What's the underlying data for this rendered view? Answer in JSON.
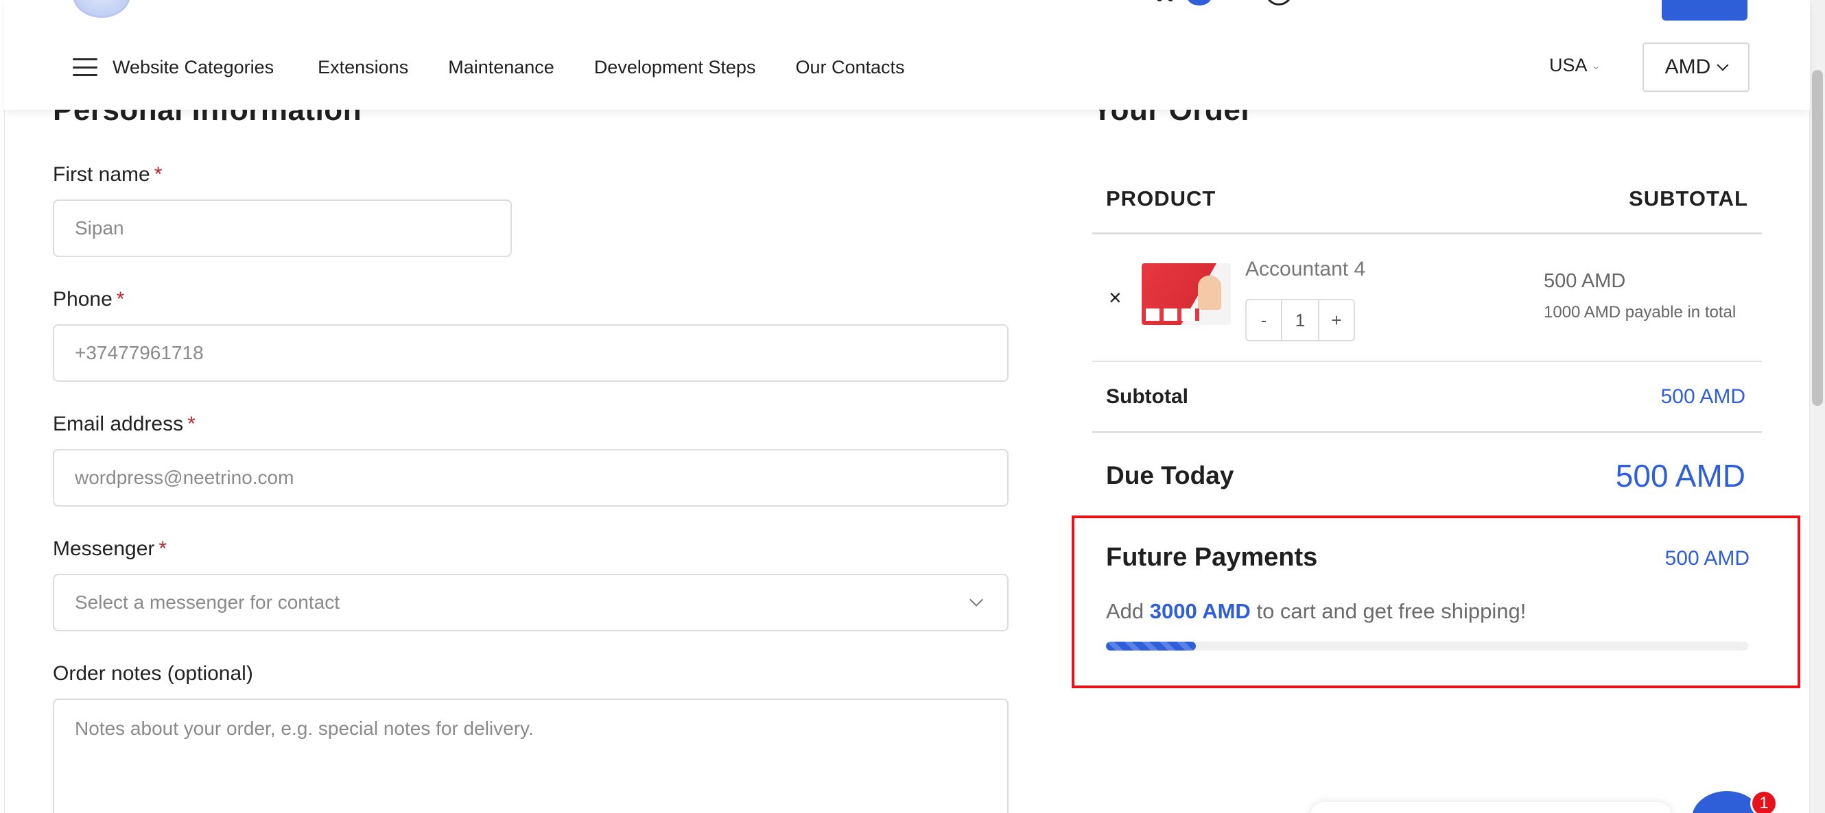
{
  "header": {
    "nav": [
      {
        "label": "Website Categories"
      },
      {
        "label": "Extensions"
      },
      {
        "label": "Maintenance"
      },
      {
        "label": "Development Steps"
      },
      {
        "label": "Our Contacts"
      }
    ],
    "country": "USA",
    "currency": "AMD",
    "icons": [
      "menu-icon",
      "cart-icon",
      "user-icon",
      "chevron-down-icon"
    ]
  },
  "personal": {
    "title": "Personal Information",
    "required_mark": "*",
    "first_name": {
      "label": "First name",
      "placeholder": "Sipan"
    },
    "phone": {
      "label": "Phone",
      "placeholder": "+37477961718"
    },
    "email": {
      "label": "Email address",
      "placeholder": "wordpress@neetrino.com"
    },
    "messenger": {
      "label": "Messenger",
      "placeholder": "Select a messenger for contact"
    },
    "notes": {
      "label": "Order notes (optional)",
      "placeholder": "Notes about your order, e.g. special notes for delivery."
    }
  },
  "order": {
    "title": "Your Order",
    "col_product": "PRODUCT",
    "col_subtotal": "SUBTOTAL",
    "item": {
      "remove": "×",
      "name": "Accountant 4",
      "qty_minus": "-",
      "qty": "1",
      "qty_plus": "+",
      "price": "500 AMD",
      "price_note": "1000 AMD payable in total"
    },
    "subtotal_label": "Subtotal",
    "subtotal_value": "500 AMD",
    "due_label": "Due Today",
    "due_value": "500 AMD",
    "future": {
      "title": "Future Payments",
      "amount": "500 AMD",
      "msg_pre": "Add",
      "msg_amount": "3000 AMD",
      "msg_post": "to cart and get free shipping!",
      "progress": 0.14
    }
  },
  "chat": {
    "badge": "1"
  },
  "colors": {
    "accent": "#2f5fd8",
    "required": "#c0262d",
    "highlight_border": "#e8121b"
  }
}
